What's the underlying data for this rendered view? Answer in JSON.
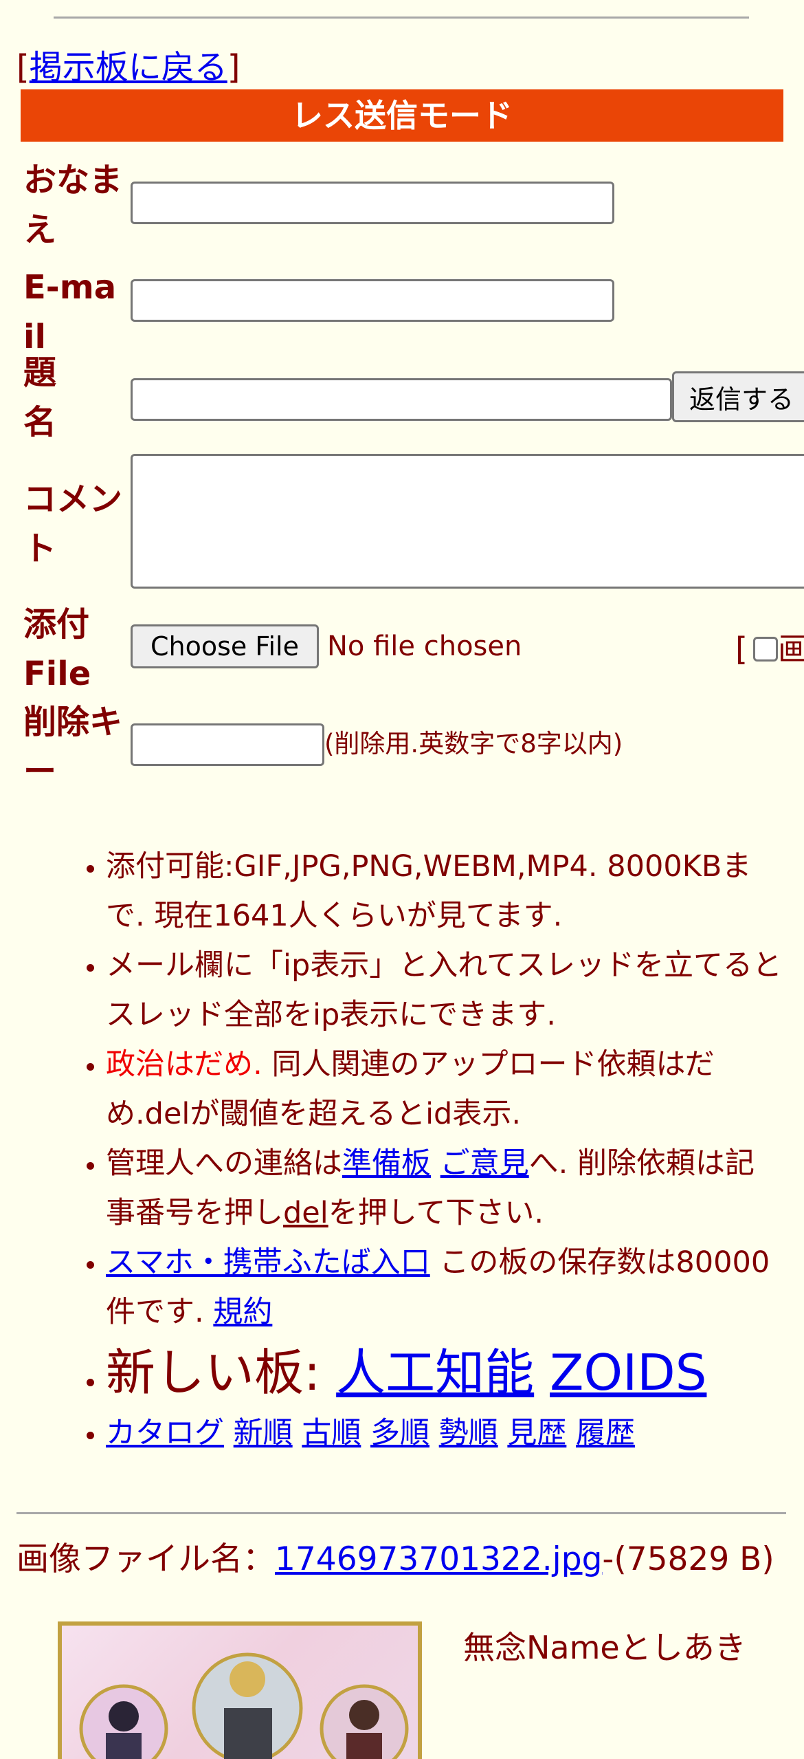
{
  "nav": {
    "back_open": "[",
    "back_link": "掲示板に戻る",
    "back_close": "]"
  },
  "mode_bar": {
    "label": "レス送信モード",
    "color": "#ea4506"
  },
  "form": {
    "name_label": "おなまえ",
    "email_label": "E-mail",
    "subject_label": "題名",
    "submit_label": "返信する",
    "comment_label": "コメント",
    "file_label": "添付File",
    "file_button": "Choose File",
    "file_status": "No file chosen",
    "image_option": "[",
    "image_option_text": "画",
    "delkey_label": "削除キー",
    "delkey_note": "(削除用.英数字で8字以内)"
  },
  "rules": {
    "item1": "添付可能:GIF,JPG,PNG,WEBM,MP4. 8000KBまで. 現在1641人くらいが見てます.",
    "item2": "メール欄に「ip表示」と入れてスレッドを立てるとスレッド全部をip表示にできます.",
    "item3_red": "政治はだめ.",
    "item3_rest": " 同人関連のアップロード依頼はだめ.delが閾値を超えるとid表示.",
    "item4_a": "管理人への連絡は",
    "item4_link1": "準備板",
    "item4_link2": "ご意見",
    "item4_b": "へ. 削除依頼は記事番号を押し",
    "item4_link3": "del",
    "item4_c": "を押して下さい.",
    "item5_link1": "スマホ・携帯ふたば入口",
    "item5_text": " この板の保存数は80000件です. ",
    "item5_link2": "規約",
    "item6_text": "新しい板: ",
    "item6_link1": "人工知能",
    "item6_link2": "ZOIDS",
    "links": [
      "カタログ",
      "新順",
      "古順",
      "多順",
      "勢順",
      "見歴",
      "履歴"
    ]
  },
  "post": {
    "file_prefix": "画像ファイル名：",
    "file_link": "1746973701322.jpg",
    "file_size": "-(75829 B)",
    "poster": "無念Nameとしあき"
  }
}
